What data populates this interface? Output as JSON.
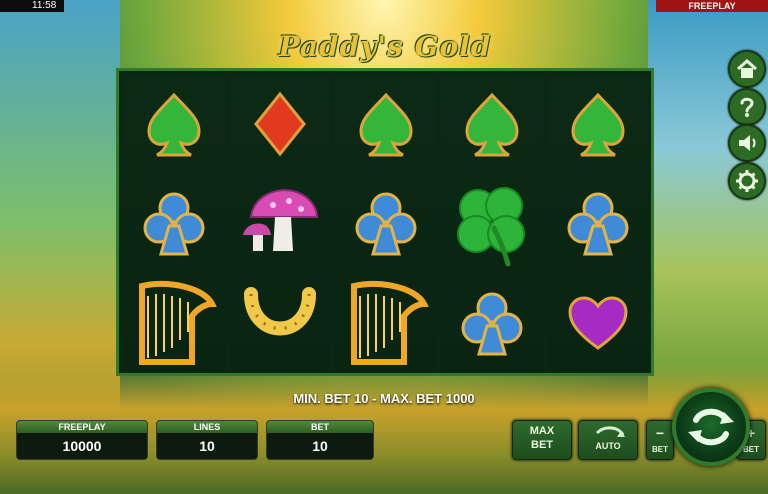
{
  "status": {
    "time": "11:58",
    "mode": "FREEPLAY"
  },
  "logo": {
    "text": "Paddy's Gold"
  },
  "reels": [
    [
      "spade-green",
      "club-blue",
      "harp"
    ],
    [
      "diamond-red",
      "mushroom",
      "horseshoe"
    ],
    [
      "spade-green",
      "club-blue",
      "harp"
    ],
    [
      "spade-green",
      "clover",
      "club-blue"
    ],
    [
      "spade-green",
      "club-blue",
      "heart-purple"
    ]
  ],
  "info": {
    "min_max": "MIN. BET 10 - MAX. BET 1000"
  },
  "panels": [
    {
      "label": "FREEPLAY",
      "value": "10000"
    },
    {
      "label": "LINES",
      "value": "10"
    },
    {
      "label": "BET",
      "value": "10"
    }
  ],
  "buttons": {
    "max_bet_top": "MAX",
    "max_bet_bottom": "BET",
    "auto": "AUTO",
    "bet_minus": "BET",
    "bet_plus": "BET"
  },
  "icons": {
    "home": "home-icon",
    "help": "help-icon",
    "sound": "sound-icon",
    "settings": "gear-icon",
    "spin": "spin-arrows-icon"
  },
  "colors": {
    "accent_green": "#2f7a2c",
    "gold": "#e9c23b",
    "freeplay_red": "#a01414"
  }
}
